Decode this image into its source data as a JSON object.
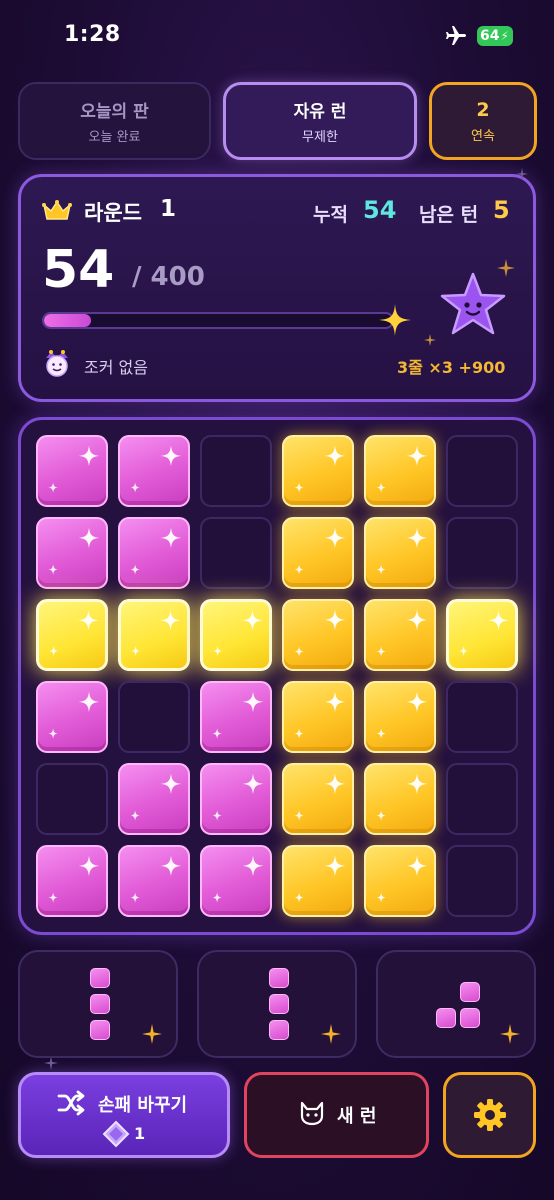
{
  "status": {
    "time": "1:28",
    "battery": "64"
  },
  "tabs": [
    {
      "title": "오늘의 판",
      "sub": "오늘 완료"
    },
    {
      "title": "자유 런",
      "sub": "무제한"
    },
    {
      "title": "2",
      "sub": "연속"
    }
  ],
  "panel": {
    "round_label": "라운드",
    "round_num": "1",
    "accum_label": "누적",
    "accum_value": "54",
    "turns_label": "남은 턴",
    "turns_value": "5",
    "score": "54",
    "target": "/ 400",
    "progress": 0.135,
    "joker_text": "조커 없음",
    "combo_text": "3줄 ×3 +900"
  },
  "board": [
    [
      "pink",
      "pink",
      "empty",
      "gold",
      "gold",
      "empty"
    ],
    [
      "pink",
      "pink",
      "empty",
      "gold",
      "gold",
      "empty"
    ],
    [
      "hl",
      "hl",
      "hl",
      "gold",
      "gold",
      "hl"
    ],
    [
      "pink",
      "empty",
      "pink",
      "gold",
      "gold",
      "empty"
    ],
    [
      "empty",
      "pink",
      "pink",
      "gold",
      "gold",
      "empty"
    ],
    [
      "pink",
      "pink",
      "pink",
      "gold",
      "gold",
      "empty"
    ]
  ],
  "pieces": [
    {
      "name": "vertical-3"
    },
    {
      "name": "vertical-3"
    },
    {
      "name": "corner-3"
    }
  ],
  "buttons": {
    "shuffle_label": "손패 바꾸기",
    "shuffle_cost": "1",
    "new_run_label": "새 런"
  },
  "colors": {
    "pink": "#e15ad6",
    "gold": "#ffc626",
    "accent": "#8c5adf",
    "cyan": "#5ee6e0",
    "orange": "#f2a521"
  }
}
